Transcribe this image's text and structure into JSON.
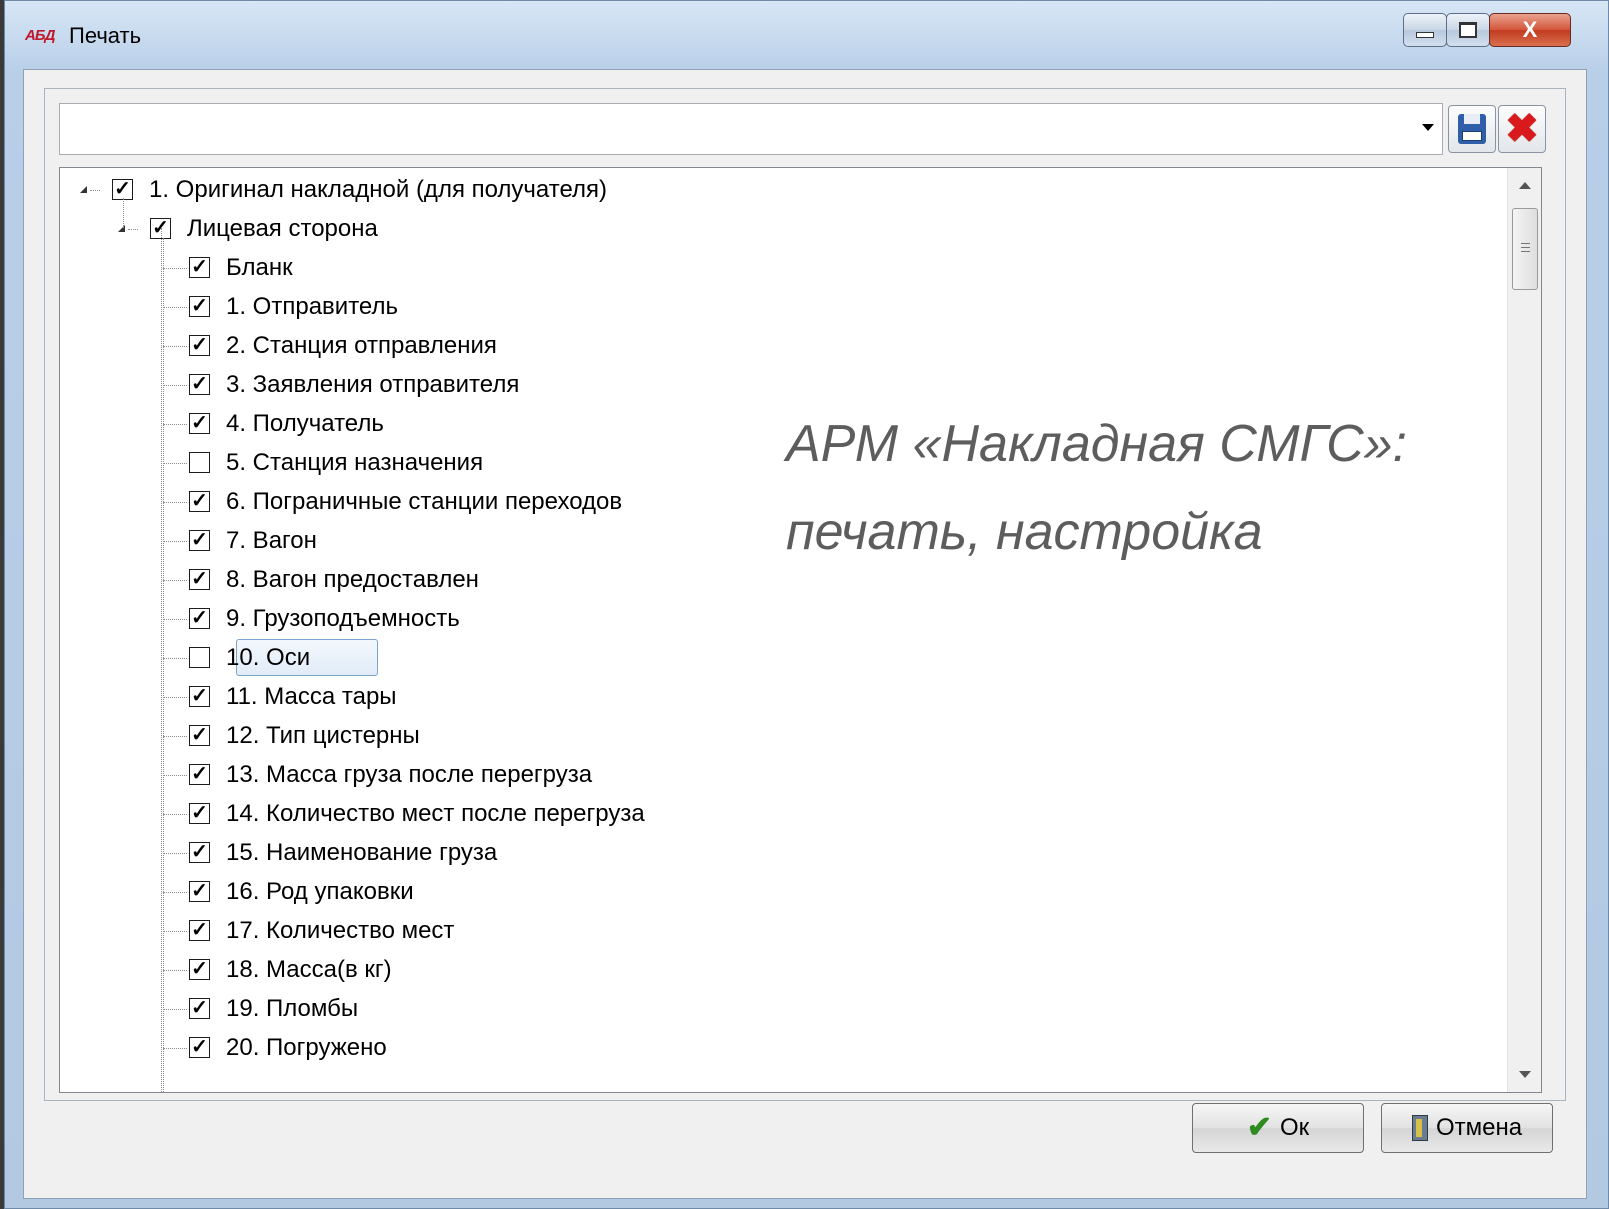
{
  "window": {
    "title": "Печать",
    "app_icon_text": "АБД",
    "close_glyph": "X"
  },
  "combo": {
    "value": ""
  },
  "tree": {
    "root": {
      "label": "1. Оригинал накладной (для получателя)",
      "checked": true,
      "expanded": true
    },
    "section": {
      "label": "Лицевая сторона",
      "checked": true,
      "expanded": true
    },
    "items": [
      {
        "label": "Бланк",
        "checked": true
      },
      {
        "label": "1. Отправитель",
        "checked": true
      },
      {
        "label": "2. Станция отправления",
        "checked": true
      },
      {
        "label": "3. Заявления отправителя",
        "checked": true
      },
      {
        "label": "4. Получатель",
        "checked": true
      },
      {
        "label": "5. Станция назначения",
        "checked": false
      },
      {
        "label": "6. Пограничные станции переходов",
        "checked": true
      },
      {
        "label": "7. Вагон",
        "checked": true
      },
      {
        "label": "8. Вагон предоставлен",
        "checked": true
      },
      {
        "label": "9. Грузоподъемность",
        "checked": true
      },
      {
        "label": "10. Оси",
        "checked": false,
        "selected": true
      },
      {
        "label": "11. Масса тары",
        "checked": true
      },
      {
        "label": "12. Тип цистерны",
        "checked": true
      },
      {
        "label": "13. Масса груза после перегруза",
        "checked": true
      },
      {
        "label": "14. Количество мест после перегруза",
        "checked": true
      },
      {
        "label": "15. Наименование груза",
        "checked": true
      },
      {
        "label": "16. Род упаковки",
        "checked": true
      },
      {
        "label": "17. Количество мест",
        "checked": true
      },
      {
        "label": "18. Масса(в кг)",
        "checked": true
      },
      {
        "label": "19. Пломбы",
        "checked": true
      },
      {
        "label": "20. Погружено",
        "checked": true
      }
    ]
  },
  "overlay": {
    "line1": "АРМ «Накладная СМГС»:",
    "line2": "печать, настройка"
  },
  "buttons": {
    "ok_label": "Ок",
    "cancel_label": "Отмена"
  },
  "check_glyph": "✓"
}
